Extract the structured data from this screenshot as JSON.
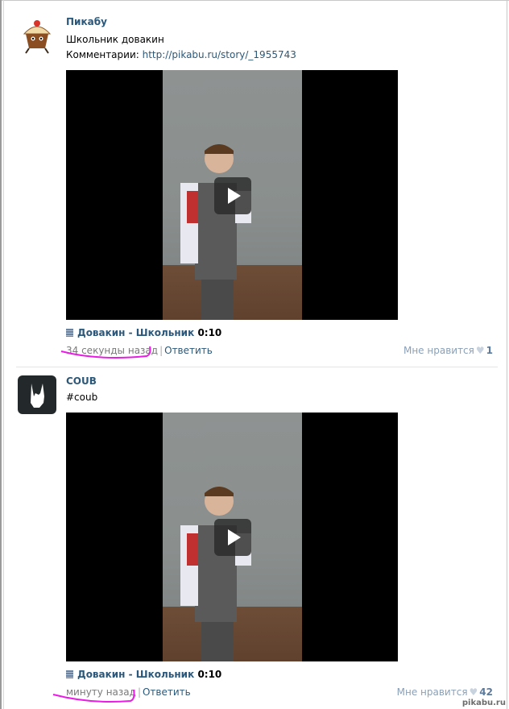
{
  "posts": [
    {
      "author": "Пикабу",
      "text": "Школьник довакин",
      "comment_label": "Комментарии:",
      "comment_link": "http://pikabu.ru/story/_1955743",
      "video_title": "Довакин - Школьник",
      "video_duration": "0:10",
      "time": "34 секунды назад",
      "reply": "Ответить",
      "like_label": "Мне нравится",
      "like_count": "1"
    },
    {
      "author": "COUB",
      "text": "#coub",
      "video_title": "Довакин - Школьник",
      "video_duration": "0:10",
      "time": "минуту назад",
      "reply": "Ответить",
      "like_label": "Мне нравится",
      "like_count": "42"
    }
  ],
  "watermark": "pikabu.ru",
  "colors": {
    "link": "#2b587a",
    "highlight": "#e91ee4"
  },
  "icons": [
    "pikabu-cupcake-avatar",
    "coub-horns-avatar",
    "video-icon",
    "play-icon",
    "heart-icon"
  ]
}
